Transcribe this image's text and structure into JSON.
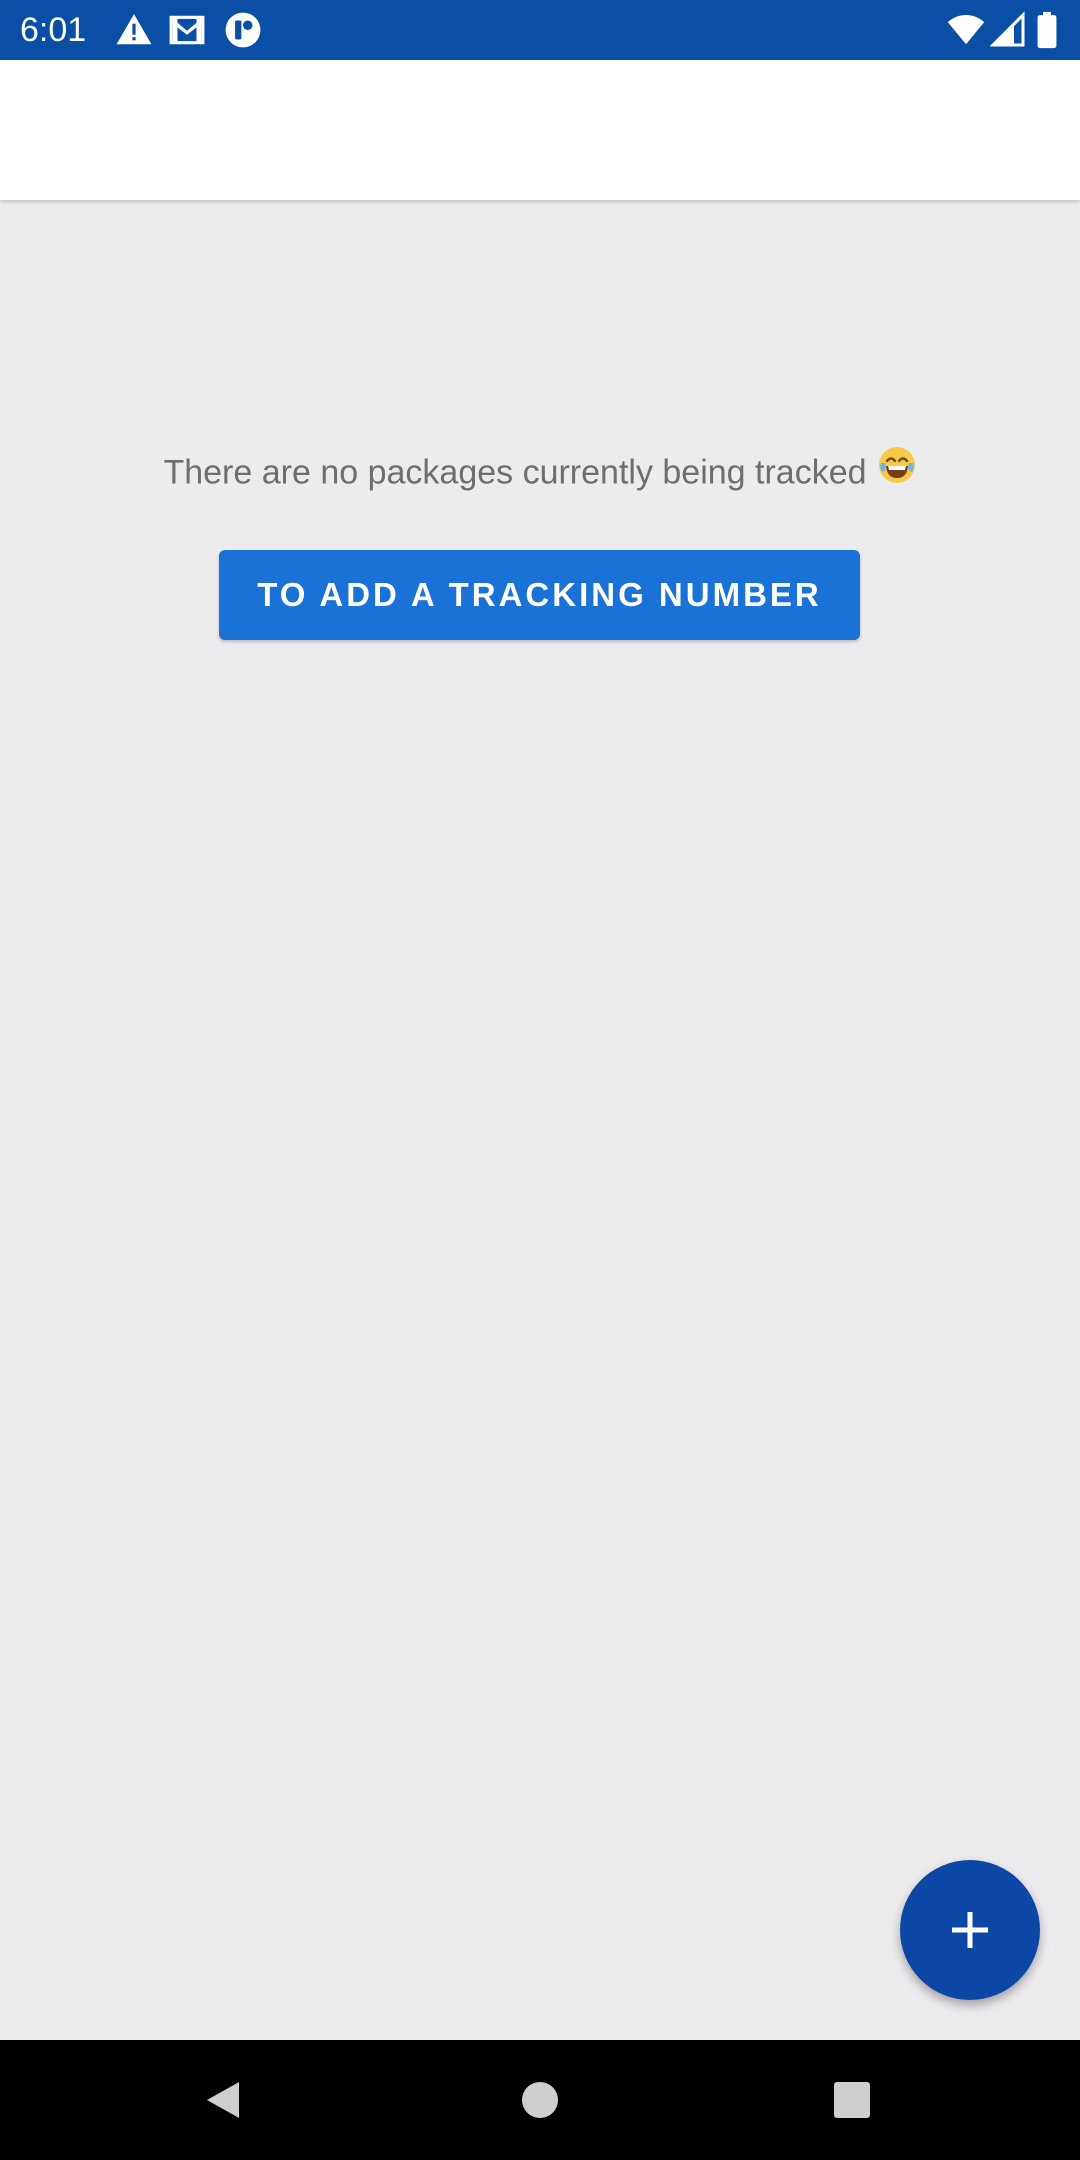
{
  "status_bar": {
    "time": "6:01",
    "icons_left": [
      "warning-icon",
      "gmail-icon",
      "app-notification-icon"
    ],
    "icons_right": [
      "wifi-icon",
      "cell-signal-icon",
      "battery-icon"
    ],
    "background_color": "#0A4EA6"
  },
  "empty_state": {
    "message": "There are no packages currently being tracked",
    "emoji": "😂",
    "button_label": "TO ADD A TRACKING NUMBER",
    "button_color": "#1B72D6"
  },
  "fab": {
    "icon": "plus-icon",
    "color": "#0D47A6"
  },
  "nav_bar": {
    "buttons": [
      "back-icon",
      "home-icon",
      "recents-icon"
    ]
  }
}
